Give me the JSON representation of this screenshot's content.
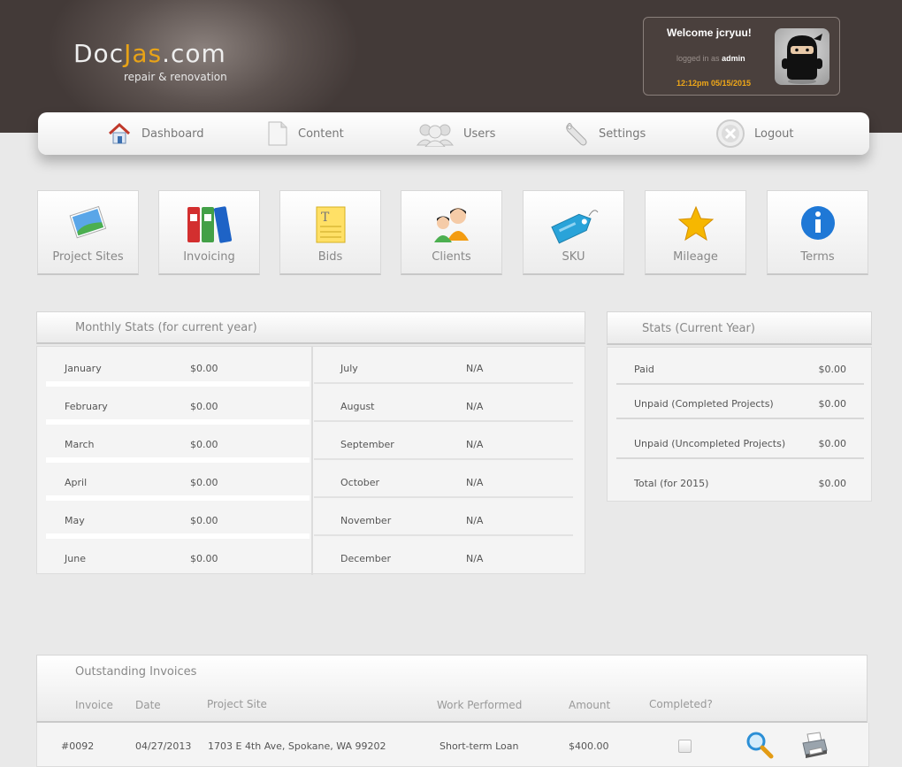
{
  "header": {
    "logo_part1": "Doc",
    "logo_part2": "Jas",
    "logo_part3": ".com",
    "tagline": "repair & renovation",
    "welcome": "Welcome jcryuu!",
    "logged_in_prefix": "logged in as",
    "role": "admin",
    "datetime": "12:12pm 05/15/2015"
  },
  "nav": {
    "dashboard": "Dashboard",
    "content": "Content",
    "users": "Users",
    "settings": "Settings",
    "logout": "Logout"
  },
  "tiles": {
    "project_sites": "Project Sites",
    "invoicing": "Invoicing",
    "bids": "Bids",
    "clients": "Clients",
    "sku": "SKU",
    "mileage": "Mileage",
    "terms": "Terms"
  },
  "monthly": {
    "title": "Monthly Stats (for current year)",
    "left": [
      {
        "month": "January",
        "value": "$0.00"
      },
      {
        "month": "February",
        "value": "$0.00"
      },
      {
        "month": "March",
        "value": "$0.00"
      },
      {
        "month": "April",
        "value": "$0.00"
      },
      {
        "month": "May",
        "value": "$0.00"
      },
      {
        "month": "June",
        "value": "$0.00"
      }
    ],
    "right": [
      {
        "month": "July",
        "value": "N/A"
      },
      {
        "month": "August",
        "value": "N/A"
      },
      {
        "month": "September",
        "value": "N/A"
      },
      {
        "month": "October",
        "value": "N/A"
      },
      {
        "month": "November",
        "value": "N/A"
      },
      {
        "month": "December",
        "value": "N/A"
      }
    ]
  },
  "year_stats": {
    "title": "Stats (Current Year)",
    "rows": [
      {
        "label": "Paid",
        "value": "$0.00"
      },
      {
        "label": "Unpaid (Completed Projects)",
        "value": "$0.00"
      },
      {
        "label": "Unpaid (Uncompleted Projects)",
        "value": "$0.00"
      },
      {
        "label": "Total (for 2015)",
        "value": "$0.00"
      }
    ]
  },
  "invoices": {
    "title": "Outstanding Invoices",
    "columns": {
      "invoice": "Invoice",
      "date": "Date",
      "project_site": "Project Site",
      "work": "Work Performed",
      "amount": "Amount",
      "completed": "Completed?"
    },
    "rows": [
      {
        "invoice": "#0092",
        "date": "04/27/2013",
        "site": "1703 E 4th Ave, Spokane, WA 99202",
        "work": "Short-term Loan",
        "amount": "$400.00",
        "completed": false
      }
    ]
  },
  "colors": {
    "header_bg": "#433a38",
    "accent": "#e8a317",
    "page_bg": "#e9e9e9"
  }
}
